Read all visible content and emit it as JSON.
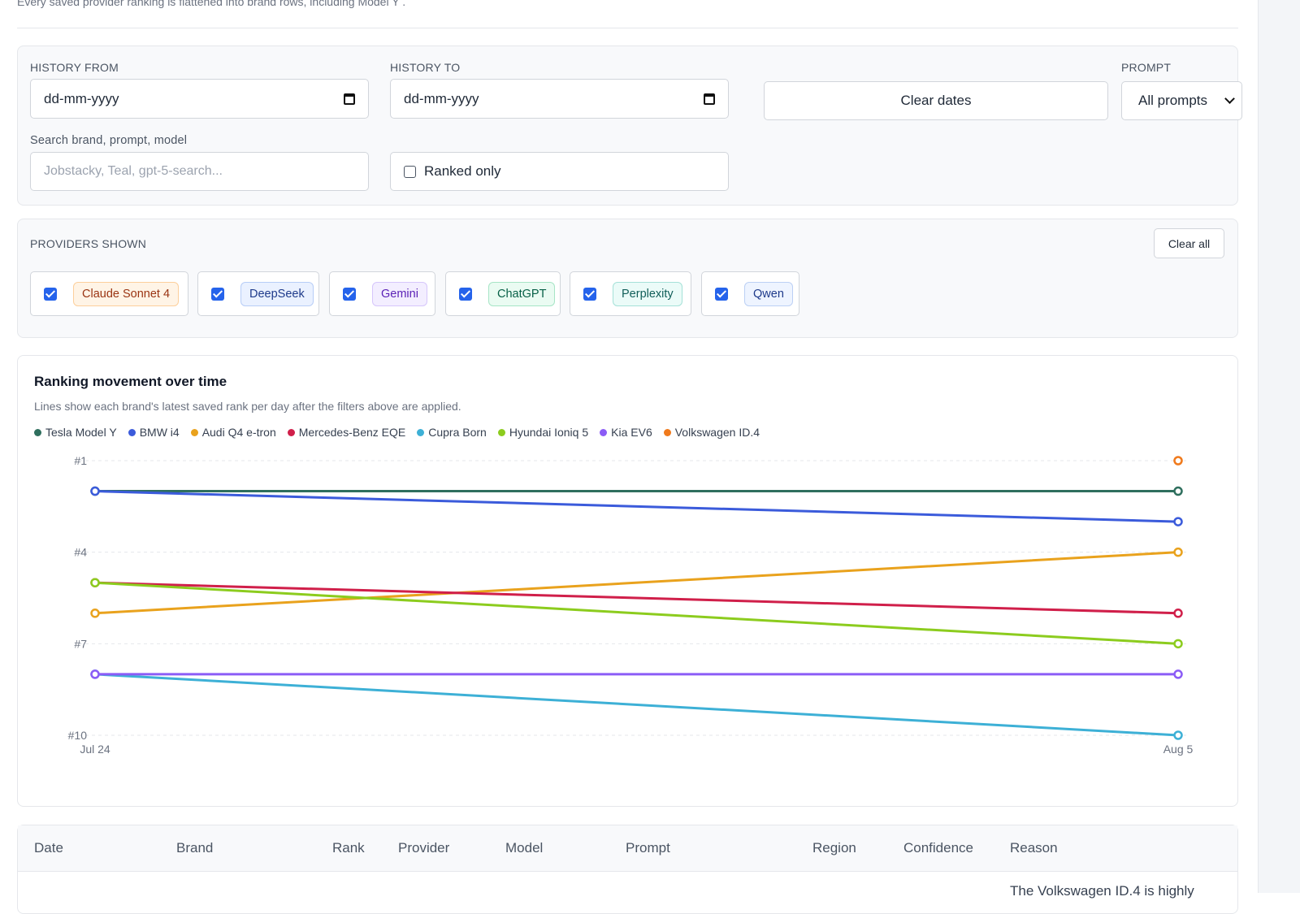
{
  "page": {
    "note": "Every saved provider ranking is flattened into brand rows, including Model Y ."
  },
  "filters": {
    "history_from_label": "HISTORY FROM",
    "history_from_value": "dd-mm-yyyy",
    "history_to_label": "HISTORY TO",
    "history_to_value": "dd-mm-yyyy",
    "clear_dates_label": "Clear dates",
    "prompt_label": "PROMPT",
    "prompt_value": "All prompts",
    "search_label": "Search brand, prompt, model",
    "search_placeholder": "Jobstacky, Teal, gpt-5-search...",
    "ranked_only_label": "Ranked only"
  },
  "providers": {
    "label": "PROVIDERS SHOWN",
    "clear_all_label": "Clear all",
    "items": [
      {
        "name": "Claude Sonnet 4",
        "checked": true,
        "color": "#c2410c"
      },
      {
        "name": "DeepSeek",
        "checked": true,
        "color": "#1e40af"
      },
      {
        "name": "Gemini",
        "checked": true,
        "color": "#6d28d9"
      },
      {
        "name": "ChatGPT",
        "checked": true,
        "color": "#047857"
      },
      {
        "name": "Perplexity",
        "checked": true,
        "color": "#0f766e"
      },
      {
        "name": "Qwen",
        "checked": true,
        "color": "#1e3a8a"
      }
    ]
  },
  "chart": {
    "title": "Ranking movement over time",
    "subtitle": "Lines show each brand's latest saved rank per day after the filters above are applied."
  },
  "chart_data": {
    "type": "line",
    "x": [
      "Jul 24",
      "Aug 5"
    ],
    "y_ticks": [
      "#1",
      "#4",
      "#7",
      "#10"
    ],
    "ylim": [
      1,
      10
    ],
    "y_inverted": true,
    "grid": true,
    "legend": "top-left",
    "series": [
      {
        "name": "Tesla Model Y",
        "color": "#2f6f5e",
        "values": [
          2,
          2
        ]
      },
      {
        "name": "BMW i4",
        "color": "#3b5bdb",
        "values": [
          2,
          3
        ]
      },
      {
        "name": "Audi Q4 e-tron",
        "color": "#e9a21d",
        "values": [
          6,
          4
        ]
      },
      {
        "name": "Mercedes-Benz EQE",
        "color": "#d01f4a",
        "values": [
          5,
          6
        ]
      },
      {
        "name": "Cupra Born",
        "color": "#3db0d6",
        "values": [
          8,
          10
        ]
      },
      {
        "name": "Hyundai Ioniq 5",
        "color": "#8ccc1e",
        "values": [
          5,
          7
        ]
      },
      {
        "name": "Kia EV6",
        "color": "#8b5cf6",
        "values": [
          8,
          8
        ]
      },
      {
        "name": "Volkswagen ID.4",
        "color": "#f07a1c",
        "values": [
          null,
          1
        ]
      }
    ]
  },
  "table": {
    "headers": [
      "Date",
      "Brand",
      "Rank",
      "Provider",
      "Model",
      "Prompt",
      "Region",
      "Confidence",
      "Reason"
    ],
    "reason_peek": "The Volkswagen ID.4 is highly"
  }
}
